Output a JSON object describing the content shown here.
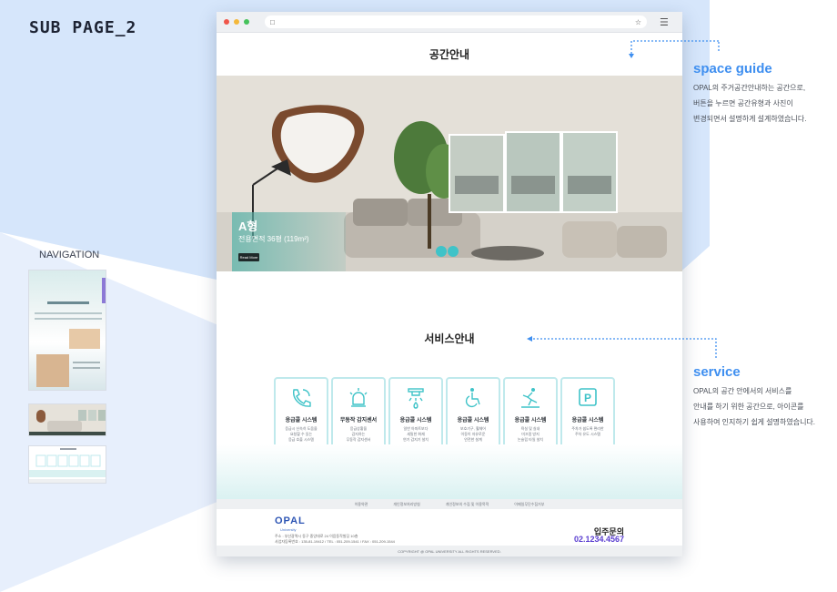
{
  "page": {
    "title": "SUB PAGE_2",
    "nav_label": "NAVIGATION",
    "nav_thumb_labels": [
      "",
      ""
    ]
  },
  "browser": {
    "url_icons": {
      "lock": "lock-icon",
      "star": "star-icon",
      "menu": "hamburger-menu-icon"
    },
    "dot_colors": [
      "#f0564a",
      "#f4b83a",
      "#45c25b"
    ]
  },
  "space": {
    "heading": "공간안내",
    "hero_title": "A형",
    "hero_subtitle": "전용면적 36평 (119m²)",
    "hero_button": "Read More"
  },
  "service": {
    "heading": "서비스안내",
    "cards": [
      {
        "icon": "phone-call-icon",
        "title": "응급콜 시스템",
        "desc": "응급시 신속히 도움을\n요청할 수 있는\n응급 호출 시스템"
      },
      {
        "icon": "siren-alarm-icon",
        "title": "무동작 감지센서",
        "desc": "응급상황을\n감지하는\n무동작 감지센서"
      },
      {
        "icon": "sprinkler-icon",
        "title": "응급콜 시스템",
        "desc": "일반 아파트보다\n세밀한 화재\n연기 감지기 설치"
      },
      {
        "icon": "wheelchair-icon",
        "title": "응급콜 시스템",
        "desc": "보호기구, 휠체어\n이동이 자유로운\n안전한 설계"
      },
      {
        "icon": "slip-fall-icon",
        "title": "응급콜 시스템",
        "desc": "욕실 및 실내\n미끄럼 방지\n논슬립 타일 설치"
      },
      {
        "icon": "parking-icon",
        "title": "응급콜 시스템",
        "desc": "주차가 쉽도록 편리한\n주차 유도 시스템"
      }
    ]
  },
  "footer": {
    "links": [
      "이용약관",
      "개인정보처리방침",
      "개인정보의 수집 및 이용목적",
      "이메일무단수집거부"
    ],
    "logo": "OPAL",
    "logo_sub": "University",
    "address": "주소 : 부산광역시 동구 중앙대로 24 이음동작빌딩 10층",
    "biz": "사업자등록번호 : 135-81-19412 / TEL : 051-209-1541 / FAX : 051-209-1544",
    "inquiry_label": "입주문의",
    "inquiry_number": "02.1234.4567",
    "copyright": "COPYRIGHT @ OPAL UNIVERSITY ALL RIGHTS RESERVED."
  },
  "annotations": {
    "space_heading": "space guide",
    "space_text": "OPAL의 주거공간안내하는 공간으로,\n버튼을 누르면 공간유형과 사진이\n변경되면서 설명하게 설계하였습니다.",
    "service_heading": "service",
    "service_text": "OPAL의 공간 안에서의 서비스를\n안내를 하기 위한 공간으로, 아이콘를\n사용하여 인지하기 쉽게 설명하였습니다."
  },
  "colors": {
    "accent": "#3f8ff0",
    "teal": "#3fc3c8",
    "inquiry": "#5b3fd1",
    "background_blue": "#d6e6fb"
  }
}
